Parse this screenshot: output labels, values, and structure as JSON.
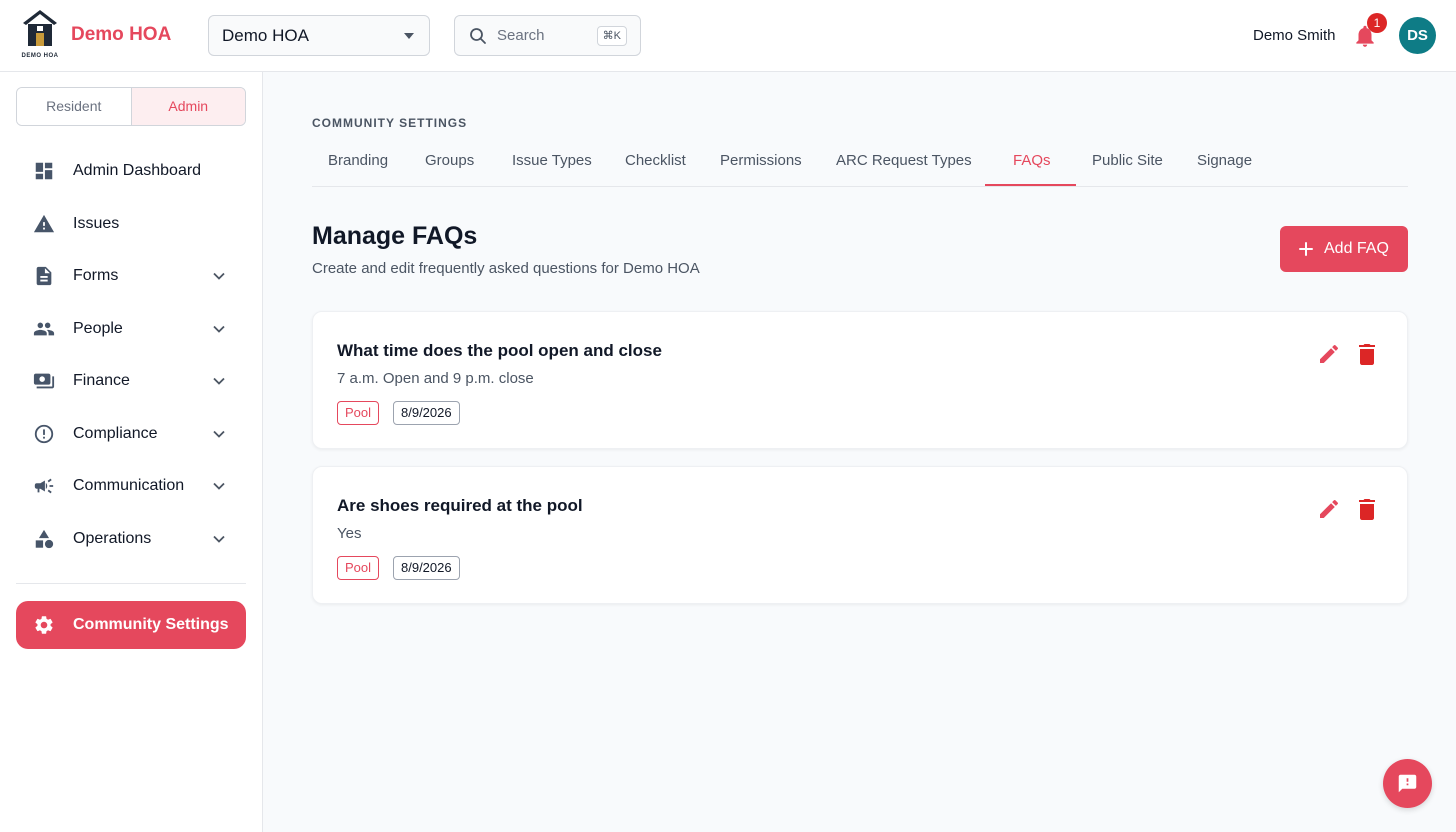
{
  "header": {
    "logo_caption": "DEMO HOA",
    "brand": "Demo HOA",
    "hoa_select_value": "Demo HOA",
    "search_placeholder": "Search",
    "search_shortcut": "⌘K",
    "user_name": "Demo Smith",
    "notification_count": "1",
    "avatar_initials": "DS"
  },
  "sidebar": {
    "roles": {
      "resident": "Resident",
      "admin": "Admin",
      "selected": "Admin"
    },
    "items": [
      {
        "label": "Admin Dashboard",
        "icon": "dashboard-icon",
        "expandable": false
      },
      {
        "label": "Issues",
        "icon": "warning-icon",
        "expandable": false
      },
      {
        "label": "Forms",
        "icon": "document-icon",
        "expandable": true
      },
      {
        "label": "People",
        "icon": "people-icon",
        "expandable": true
      },
      {
        "label": "Finance",
        "icon": "money-icon",
        "expandable": true
      },
      {
        "label": "Compliance",
        "icon": "alert-circle-icon",
        "expandable": true
      },
      {
        "label": "Communication",
        "icon": "megaphone-icon",
        "expandable": true
      },
      {
        "label": "Operations",
        "icon": "shapes-icon",
        "expandable": true
      }
    ],
    "active_item": {
      "label": "Community Settings",
      "icon": "gear-icon"
    }
  },
  "main": {
    "section_label": "COMMUNITY SETTINGS",
    "tabs": [
      "Branding",
      "Groups",
      "Issue Types",
      "Checklist",
      "Permissions",
      "ARC Request Types",
      "FAQs",
      "Public Site",
      "Signage"
    ],
    "active_tab": "FAQs",
    "title": "Manage FAQs",
    "subtitle": "Create and edit frequently asked questions for Demo HOA",
    "add_button": "Add FAQ",
    "faqs": [
      {
        "question": "What time does the pool open and close",
        "answer": "7 a.m. Open and 9 p.m. close",
        "tag": "Pool",
        "date": "8/9/2026"
      },
      {
        "question": "Are shoes required at the pool",
        "answer": "Yes",
        "tag": "Pool",
        "date": "8/9/2026"
      }
    ]
  },
  "colors": {
    "accent": "#e5485d",
    "avatar": "#0e7c86",
    "badge": "#dc2626",
    "delete": "#dc2626"
  }
}
